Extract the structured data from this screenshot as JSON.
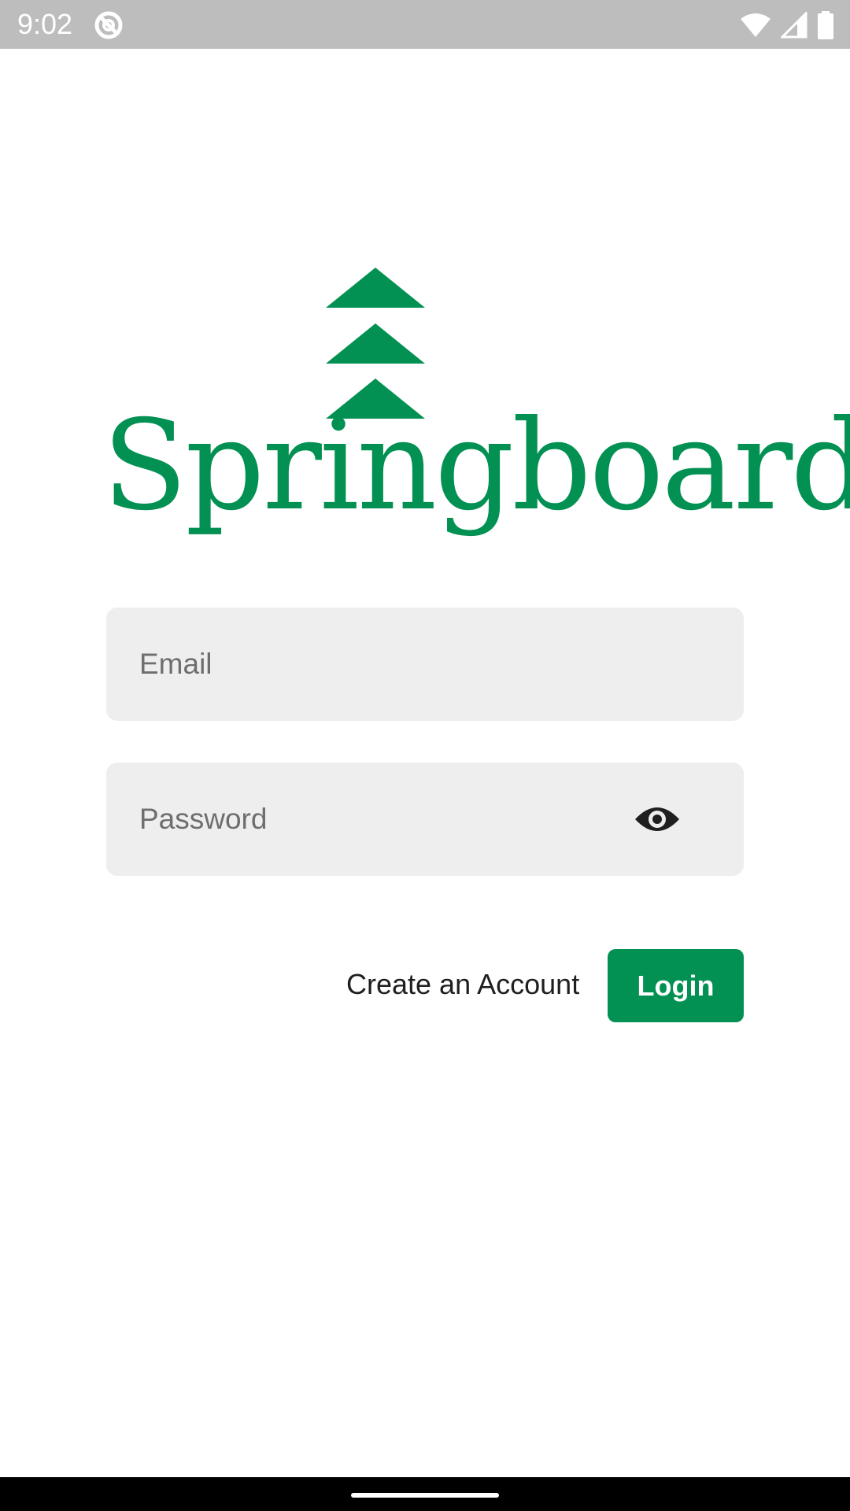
{
  "status_bar": {
    "time": "9:02",
    "app_icon": "no-sync-icon",
    "icons": [
      "wifi-icon",
      "cell-signal-icon",
      "battery-icon"
    ]
  },
  "logo": {
    "wordmark": "Springboard",
    "color": "#039153"
  },
  "form": {
    "email": {
      "value": "",
      "placeholder": "Email"
    },
    "password": {
      "value": "",
      "placeholder": "Password",
      "toggle_icon": "eye-icon"
    }
  },
  "actions": {
    "create_account_label": "Create an Account",
    "login_label": "Login"
  },
  "colors": {
    "accent": "#039153",
    "field_background": "#eeeeee",
    "status_bar": "#bdbdbd"
  }
}
